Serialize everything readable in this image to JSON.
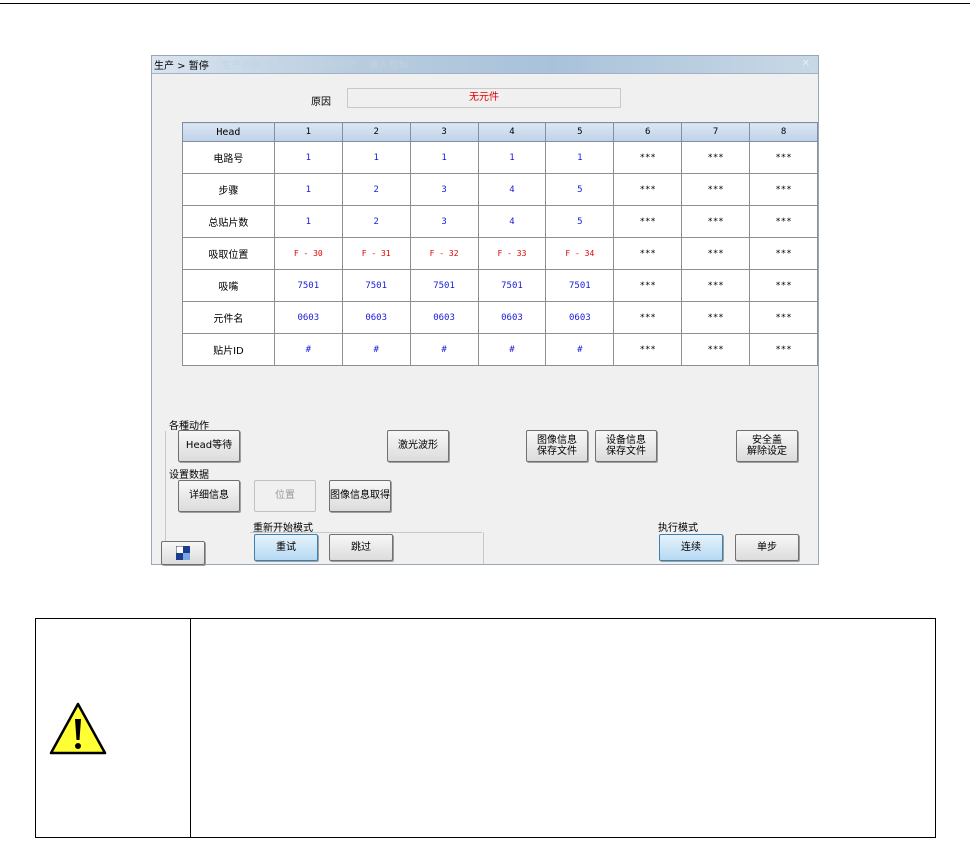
{
  "window": {
    "title": "生产 > 暂停",
    "title_ghost": "生产控制 生产状态 · 操作生产 · 输入控制"
  },
  "reason": {
    "label": "原因",
    "value": "无元件"
  },
  "table": {
    "headers": [
      "Head",
      "1",
      "2",
      "3",
      "4",
      "5",
      "6",
      "7",
      "8"
    ],
    "rows": [
      {
        "label": "电路号",
        "style": "blue",
        "cells": [
          "1",
          "1",
          "1",
          "1",
          "1",
          "***",
          "***",
          "***"
        ]
      },
      {
        "label": "步骤",
        "style": "blue",
        "cells": [
          "1",
          "2",
          "3",
          "4",
          "5",
          "***",
          "***",
          "***"
        ]
      },
      {
        "label": "总贴片数",
        "style": "blue",
        "cells": [
          "1",
          "2",
          "3",
          "4",
          "5",
          "***",
          "***",
          "***"
        ]
      },
      {
        "label": "吸取位置",
        "style": "red",
        "cells": [
          "F - 30",
          "F - 31",
          "F - 32",
          "F - 33",
          "F - 34",
          "***",
          "***",
          "***"
        ]
      },
      {
        "label": "吸嘴",
        "style": "blue",
        "cells": [
          "7501",
          "7501",
          "7501",
          "7501",
          "7501",
          "***",
          "***",
          "***"
        ]
      },
      {
        "label": "元件名",
        "style": "blue",
        "cells": [
          "0603",
          "0603",
          "0603",
          "0603",
          "0603",
          "***",
          "***",
          "***"
        ]
      },
      {
        "label": "贴片ID",
        "style": "blue",
        "cells": [
          "#",
          "#",
          "#",
          "#",
          "#",
          "***",
          "***",
          "***"
        ]
      }
    ]
  },
  "actions": {
    "group_label": "各種动作",
    "head_wait": "Head等待",
    "laser_wave": "激光波形",
    "image_save_l1": "图像信息",
    "image_save_l2": "保存文件",
    "device_save_l1": "设备信息",
    "device_save_l2": "保存文件",
    "safety_l1": "安全盖",
    "safety_l2": "解除设定"
  },
  "settings": {
    "group_label": "设置数据",
    "detail": "详细信息",
    "position": "位置",
    "image_get": "图像信息取得"
  },
  "restart": {
    "label": "重新开始模式",
    "retry": "重试",
    "skip": "跳过"
  },
  "exec": {
    "label": "执行模式",
    "continuous": "连续",
    "step": "单步"
  },
  "colors": {
    "blue_text": "#1a1adb",
    "red_text": "#e00000",
    "warning_yellow": "#ffff33"
  },
  "icons": {
    "window_small": "window-icon",
    "warning": "warning-triangle-icon"
  }
}
